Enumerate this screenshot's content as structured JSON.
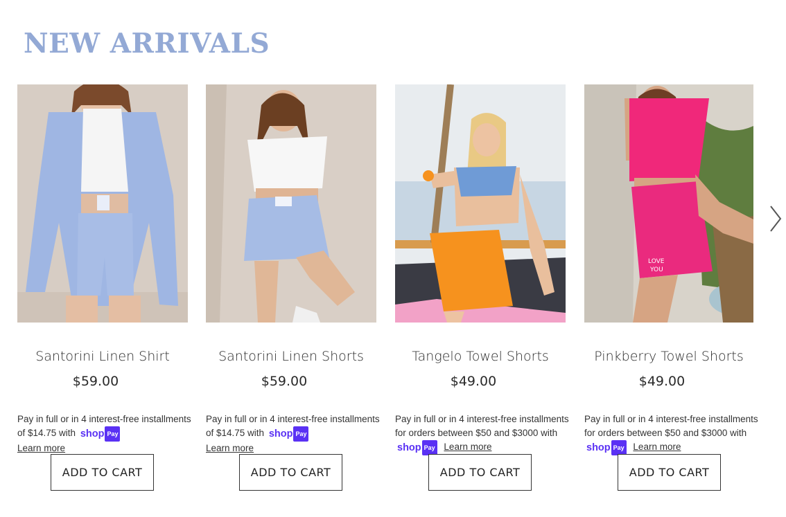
{
  "section": {
    "title": "NEW ARRIVALS"
  },
  "products": [
    {
      "name": "Santorini Linen Shirt",
      "price": "$59.00",
      "installments_text": "Pay in full or in 4 interest-free installments of $14.75 with",
      "shop_logo": "shop",
      "pay_badge": "Pay",
      "learn_more": "Learn more",
      "add_to_cart": "ADD TO CART",
      "image": "woman in light blue linen shirt and shorts"
    },
    {
      "name": "Santorini Linen Shorts",
      "price": "$59.00",
      "installments_text": "Pay in full or in 4 interest-free installments of $14.75 with",
      "shop_logo": "shop",
      "pay_badge": "Pay",
      "learn_more": "Learn more",
      "add_to_cart": "ADD TO CART",
      "image": "woman in white tee and light blue shorts"
    },
    {
      "name": "Tangelo Towel Shorts",
      "price": "$49.00",
      "installments_text": "Pay in full or in 4 interest-free installments for orders between $50 and $3000 with",
      "shop_logo": "shop",
      "pay_badge": "Pay",
      "learn_more": "Learn more",
      "add_to_cart": "ADD TO CART",
      "image": "woman in blue top and orange shorts blowing bubbles"
    },
    {
      "name": "Pinkberry Towel Shorts",
      "price": "$49.00",
      "installments_text": "Pay in full or in 4 interest-free installments for orders between $50 and $3000 with",
      "shop_logo": "shop",
      "pay_badge": "Pay",
      "learn_more": "Learn more",
      "add_to_cart": "ADD TO CART",
      "image": "woman in pink crop polo and pink shorts"
    }
  ],
  "carousel": {
    "next_icon": "chevron-right-icon"
  },
  "colors": {
    "title": "#93a9d5",
    "shop_pay": "#5a31f4",
    "text": "#2a2a2a"
  }
}
